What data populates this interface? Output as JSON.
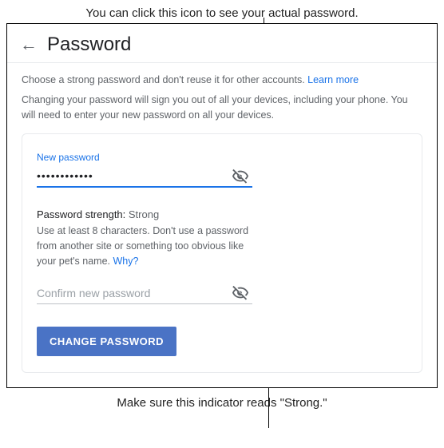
{
  "annotation": {
    "top": "You can click this icon to see your actual password.",
    "bottom": "Make sure this indicator reads \"Strong.\""
  },
  "header": {
    "title": "Password"
  },
  "info": {
    "line1_prefix": "Choose a strong password and don't reuse it for other accounts. ",
    "learn_more": "Learn more",
    "line2": "Changing your password will sign you out of all your devices, including your phone. You will need to enter your new password on all your devices."
  },
  "newPassword": {
    "label": "New password",
    "value": "••••••••••••"
  },
  "strength": {
    "label": "Password strength: ",
    "value": "Strong"
  },
  "hint": {
    "text": "Use at least 8 characters. Don't use a password from another site or something too obvious like your pet's name. ",
    "why": "Why?"
  },
  "confirm": {
    "placeholder": "Confirm new password"
  },
  "button": {
    "change": "CHANGE PASSWORD"
  }
}
